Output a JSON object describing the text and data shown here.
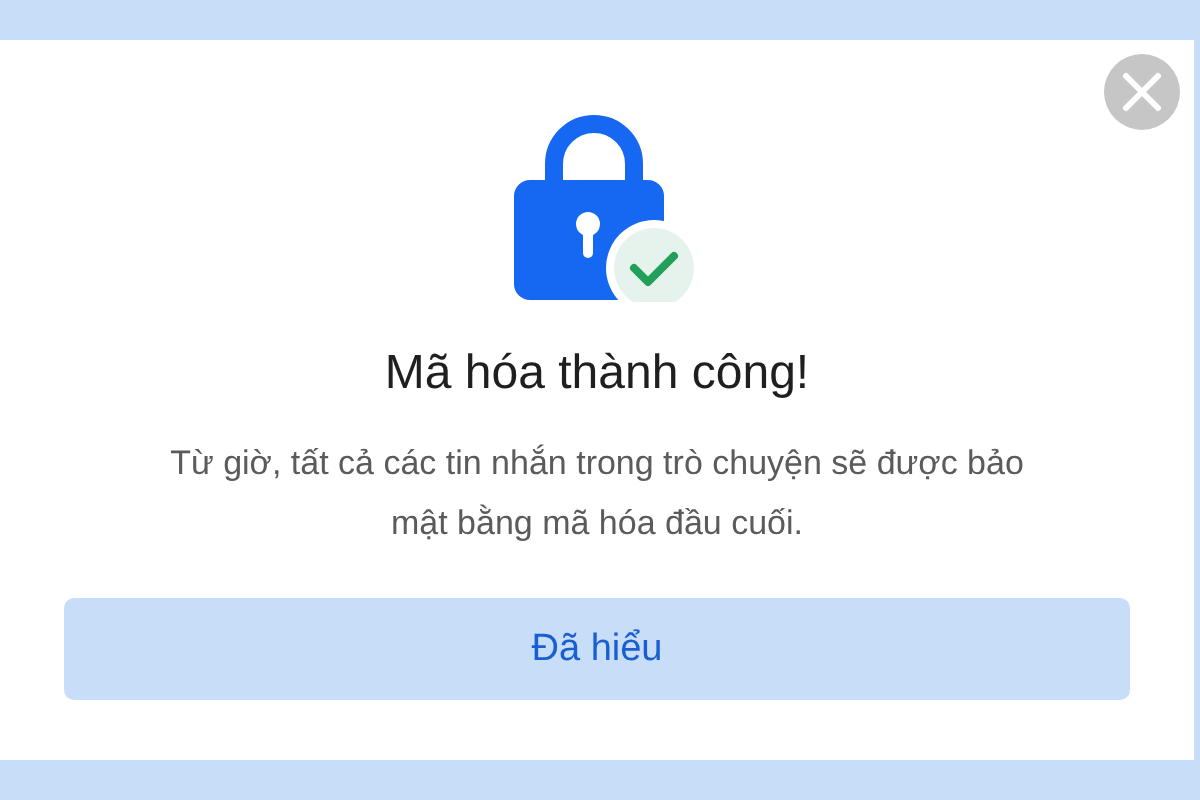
{
  "dialog": {
    "title": "Mã hóa thành công!",
    "message": "Từ giờ, tất cả các tin nhắn trong trò chuyện sẽ được bảo mật bằng mã hóa đầu cuối.",
    "button": "Đã hiểu"
  }
}
